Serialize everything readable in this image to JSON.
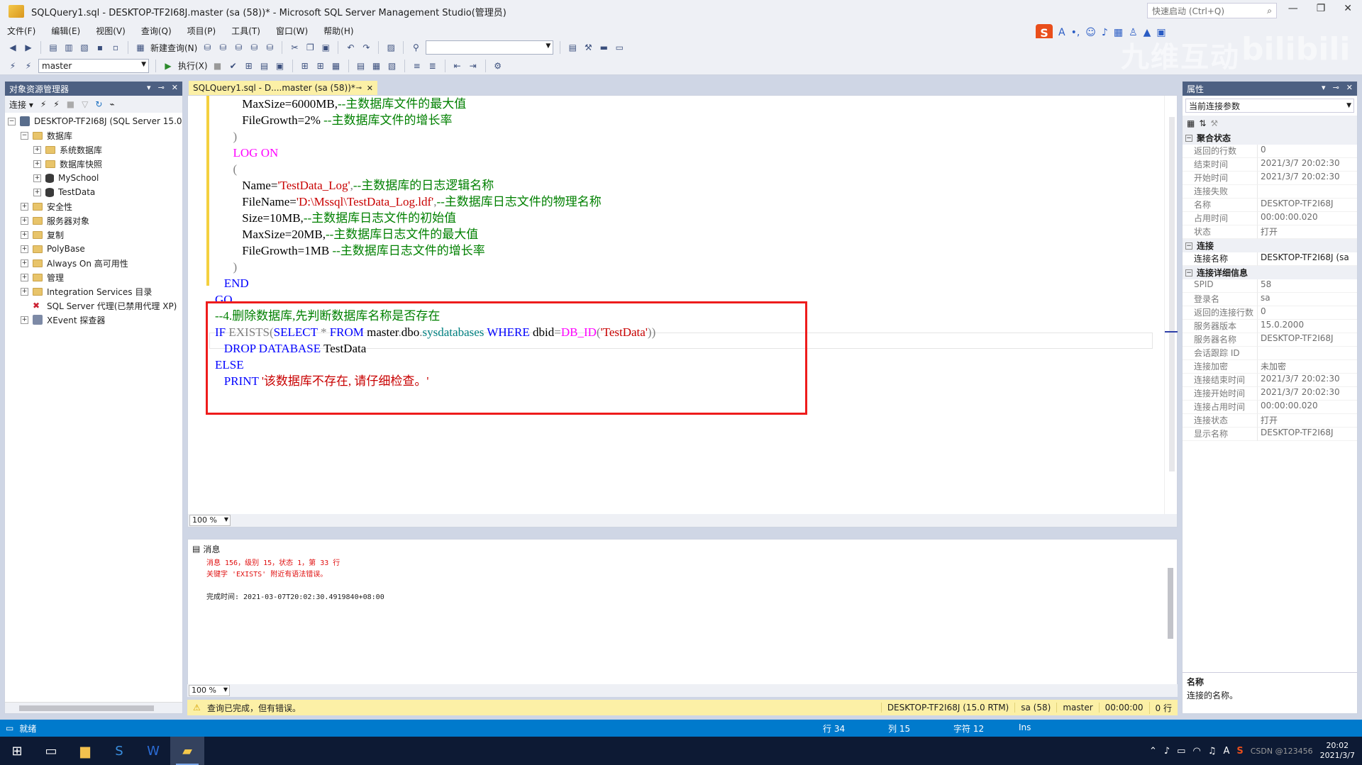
{
  "title": "SQLQuery1.sql - DESKTOP-TF2I68J.master (sa (58))* - Microsoft SQL Server Management Studio(管理员)",
  "quick_launch": {
    "placeholder": "快速启动 (Ctrl+Q)"
  },
  "menu": [
    "文件(F)",
    "编辑(E)",
    "视图(V)",
    "查询(Q)",
    "项目(P)",
    "工具(T)",
    "窗口(W)",
    "帮助(H)"
  ],
  "toolbar": {
    "new_query": "新建查询(N)",
    "execute": "执行(X)",
    "database": "master"
  },
  "object_explorer": {
    "title": "对象资源管理器",
    "connect_label": "连接",
    "server": "DESKTOP-TF2I68J (SQL Server 15.0",
    "nodes": {
      "databases": "数据库",
      "system_dbs": "系统数据库",
      "snapshots": "数据库快照",
      "myschool": "MySchool",
      "testdata": "TestData",
      "security": "安全性",
      "server_objects": "服务器对象",
      "replication": "复制",
      "polybase": "PolyBase",
      "always_on": "Always On 高可用性",
      "management": "管理",
      "integration": "Integration Services 目录",
      "agent": "SQL Server 代理(已禁用代理 XP)",
      "xevent": "XEvent 探查器"
    }
  },
  "doc_tab": {
    "label": "SQLQuery1.sql - D....master (sa (58))*",
    "pin": "⊸",
    "close": "✕"
  },
  "editor": {
    "zoom": "100 %",
    "lines": {
      "l1a": "MaxSize=6000MB,",
      "l1b": "--主数据库文件的最大值",
      "l2a": "FileGrowth=2%",
      "l2b": " --主数据库文件的增长率",
      "l3": ")",
      "l4": "LOG ON",
      "l5": "(",
      "l6a": "Name=",
      "l6b": "'TestData_Log'",
      "l6c": ",",
      "l6d": "--主数据库的日志逻辑名称",
      "l7a": "FileName=",
      "l7b": "'D:\\Mssql\\TestData_Log.ldf'",
      "l7c": ",",
      "l7d": "--主数据库日志文件的物理名称",
      "l8a": "Size=10MB,",
      "l8b": "--主数据库日志文件的初始值",
      "l9a": "MaxSize=20MB,",
      "l9b": "--主数据库日志文件的最大值",
      "l10a": "FileGrowth=1MB",
      "l10b": " --主数据库日志文件的增长率",
      "l11": ")",
      "l12": "END",
      "l13": "GO",
      "l14": "--4.删除数据库,先判断数据库名称是否存在",
      "l15_if": "IF",
      "l15_exists": "EXISTS",
      "l15_p1": "(",
      "l15_select": "SELECT",
      "l15_star": " * ",
      "l15_from": "FROM",
      "l15_master": " master",
      "l15_dot1": ".",
      "l15_dbo": "dbo",
      "l15_dot2": ".",
      "l15_sysdb": "sysdatabases",
      "l15_where": " WHERE",
      "l15_dbid": " dbid",
      "l15_eq": "=",
      "l15_fn": "DB_ID",
      "l15_p2": "(",
      "l15_str": "'TestData'",
      "l15_p3": "))",
      "l16_drop": "DROP",
      "l16_db": "DATABASE",
      "l16_name": " TestData",
      "l17": "ELSE",
      "l18_print": "PRINT",
      "l18_str": "'该数据库不存在, 请仔细检查。'"
    }
  },
  "messages": {
    "tab": "消息",
    "line1": "消息 156，级别 15，状态 1，第 33 行",
    "line2": "关键字 'EXISTS' 附近有语法错误。",
    "line3": "完成时间: 2021-03-07T20:02:30.4919840+08:00",
    "zoom": "100 %"
  },
  "query_status": {
    "text": "查询已完成，但有错误。",
    "server": "DESKTOP-TF2I68J (15.0 RTM)",
    "user": "sa (58)",
    "db": "master",
    "time": "00:00:00",
    "rows": "0 行"
  },
  "properties": {
    "title": "属性",
    "combo": "当前连接参数",
    "cat1": "聚合状态",
    "cat2": "连接",
    "cat3": "连接详细信息",
    "rows1": [
      {
        "k": "返回的行数",
        "v": "0"
      },
      {
        "k": "结束时间",
        "v": "2021/3/7 20:02:30"
      },
      {
        "k": "开始时间",
        "v": "2021/3/7 20:02:30"
      },
      {
        "k": "连接失败",
        "v": ""
      },
      {
        "k": "名称",
        "v": "DESKTOP-TF2I68J"
      },
      {
        "k": "占用时间",
        "v": "00:00:00.020"
      },
      {
        "k": "状态",
        "v": "打开"
      }
    ],
    "rows2": [
      {
        "k": "连接名称",
        "v": "DESKTOP-TF2I68J (sa"
      }
    ],
    "rows3": [
      {
        "k": "SPID",
        "v": "58"
      },
      {
        "k": "登录名",
        "v": "sa"
      },
      {
        "k": "返回的连接行数",
        "v": "0"
      },
      {
        "k": "服务器版本",
        "v": "15.0.2000"
      },
      {
        "k": "服务器名称",
        "v": "DESKTOP-TF2I68J"
      },
      {
        "k": "会话跟踪 ID",
        "v": ""
      },
      {
        "k": "连接加密",
        "v": "未加密"
      },
      {
        "k": "连接结束时间",
        "v": "2021/3/7 20:02:30"
      },
      {
        "k": "连接开始时间",
        "v": "2021/3/7 20:02:30"
      },
      {
        "k": "连接占用时间",
        "v": "00:00:00.020"
      },
      {
        "k": "连接状态",
        "v": "打开"
      },
      {
        "k": "显示名称",
        "v": "DESKTOP-TF2I68J"
      }
    ],
    "desc_title": "名称",
    "desc_text": "连接的名称。"
  },
  "statusbar": {
    "ready": "就绪",
    "line": "行 34",
    "col": "列 15",
    "char": "字符 12",
    "ins": "Ins"
  },
  "taskbar": {
    "time": "20:02",
    "date": "2021/3/7",
    "ime": "A"
  },
  "watermark": {
    "text1": "九维互动",
    "text2": "bilibili",
    "csdn": "CSDN @123456"
  }
}
